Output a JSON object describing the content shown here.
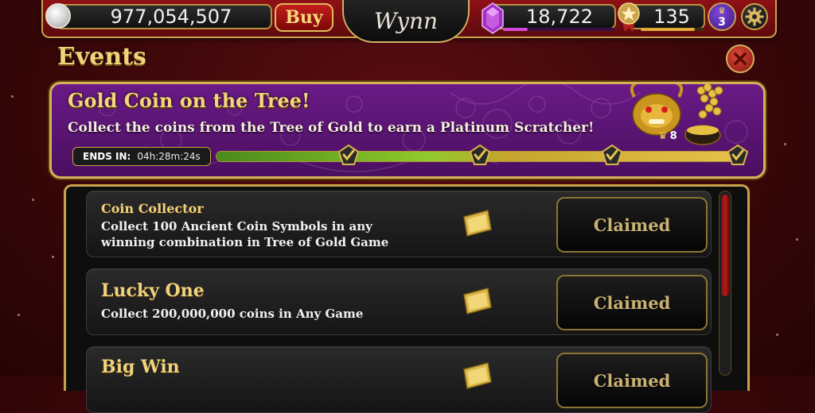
{
  "topbar": {
    "coins": "977,054,507",
    "buy_label": "Buy",
    "logo_text": "Wynn",
    "gems": "18,722",
    "gem_progress": 0.22,
    "level": "135",
    "level_progress": 0.85,
    "vip_tier": "3"
  },
  "events": {
    "title": "Events"
  },
  "banner": {
    "title": "Gold Coin on the Tree!",
    "description": "Collect the coins from the Tree of Gold to earn a Platinum Scratcher!",
    "ends_label": "ENDS IN:",
    "ends_value": "04h:28m:24s",
    "progress": 1.0,
    "checkpoints": 4,
    "reward_count": "8"
  },
  "tasks": [
    {
      "title": "Coin Collector",
      "line1": "Collect 100 Ancient Coin Symbols in any",
      "line2": "winning combination in Tree of Gold Game",
      "status": "Claimed"
    },
    {
      "title": "Lucky One",
      "line1": "Collect 200,000,000 coins in Any Game",
      "line2": "",
      "status": "Claimed"
    },
    {
      "title": "Big Win",
      "line1": "",
      "line2": "",
      "status": "Claimed"
    }
  ],
  "colors": {
    "accent_gold": "#d7b05a",
    "banner_purple": "#5c1477",
    "background_red": "#3a0709",
    "claimed_text": "#c9b272"
  },
  "icons": [
    "silver-coin-icon",
    "purple-gem-icon",
    "star-level-icon",
    "crown-icon",
    "gear-icon",
    "close-icon",
    "checkpoint-icon",
    "dragon-pot-icon",
    "golden-ticket-icon"
  ]
}
